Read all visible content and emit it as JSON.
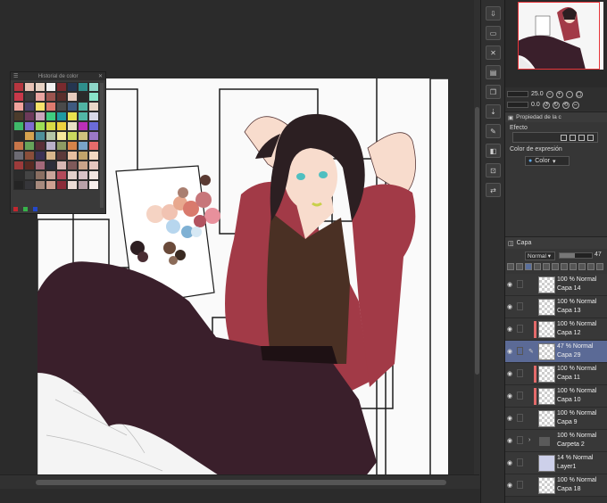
{
  "color_history": {
    "title": "Historial de color",
    "swatches": [
      "#b5363f",
      "#e8c2b5",
      "#e7d2c4",
      "#f2f2f2",
      "#7a2a2e",
      "#253550",
      "#2f8f8c",
      "#8dd6c8",
      "#c7394a",
      "#3a3a3a",
      "#e9a5a1",
      "#9d5550",
      "#5b2e2c",
      "#e7ccbf",
      "#2a2a2a",
      "#88e4c9",
      "#f0a39d",
      "#48426a",
      "#f7e36b",
      "#de7b6f",
      "#4a4a4a",
      "#3f5a80",
      "#50b3a3",
      "#e9d7c8",
      "#4b3b2b",
      "#6e3a5a",
      "#c9a5bb",
      "#3fcd7f",
      "#1f9aa2",
      "#e9e14d",
      "#52b6a6",
      "#d8d8e8",
      "#3fb86a",
      "#7f6bd0",
      "#9cde55",
      "#d8da45",
      "#f0d23f",
      "#e9e0c5",
      "#ba2fb8",
      "#6b6bd9",
      "#2b2b2b",
      "#d5a24f",
      "#4d8f9a",
      "#b4c6a7",
      "#f6e89c",
      "#c9d95e",
      "#cfc27d",
      "#9a77c6",
      "#c7764a",
      "#67a45a",
      "#5a2f37",
      "#b9b0c8",
      "#8e9b64",
      "#d7844a",
      "#79a4c9",
      "#e66b6b",
      "#6d6b74",
      "#8a4e3a",
      "#3b3355",
      "#d7b78c",
      "#5c3a3a",
      "#e7bfa0",
      "#c1a46b",
      "#f2d9c2",
      "#9c3b3b",
      "#5a2b24",
      "#a3697a",
      "#2c2e3a",
      "#d6b8b5",
      "#7f5a5a",
      "#c9a38a",
      "#e4c6bf",
      "#2c2c2c",
      "#444444",
      "#8a6f62",
      "#c9a59a",
      "#b24a5a",
      "#e3d0cb",
      "#d8c2c7",
      "#f0e4e0",
      "#242424",
      "#36363a",
      "#a78a7e",
      "#cda192",
      "#8b2c3a",
      "#ecdcd6",
      "#b8a1a8",
      "#f7efec"
    ]
  },
  "icon_strip": {
    "icons": [
      "layer-export-icon",
      "layer-folder-icon",
      "delete-layer-icon",
      "new-raster-layer-icon",
      "copy-layer-icon",
      "merge-down-icon",
      "new-vector-layer-icon",
      "mask-layer-icon",
      "reference-layer-icon",
      "transfer-layer-icon"
    ]
  },
  "navigator": {
    "zoom": "25.0",
    "rotation": "0.0"
  },
  "properties": {
    "tab_label": "Propiedad de la c",
    "effect_label": "Efecto",
    "expression_label": "Color de expresión",
    "expression_value": "Color"
  },
  "layers": {
    "tab_label": "Capa",
    "blend_mode": "Normal",
    "opacity": "47",
    "items": [
      {
        "mode": "100 % Normal",
        "name": "Capa 14",
        "selected": false,
        "clip": false,
        "type": "raster"
      },
      {
        "mode": "100 % Normal",
        "name": "Capa 13",
        "selected": false,
        "clip": false,
        "type": "raster"
      },
      {
        "mode": "100 % Normal",
        "name": "Capa 12",
        "selected": false,
        "clip": true,
        "type": "raster"
      },
      {
        "mode": "47 % Normal",
        "name": "Capa 29",
        "selected": true,
        "clip": false,
        "type": "raster"
      },
      {
        "mode": "100 % Normal",
        "name": "Capa 11",
        "selected": false,
        "clip": true,
        "type": "raster"
      },
      {
        "mode": "100 % Normal",
        "name": "Capa 10",
        "selected": false,
        "clip": true,
        "type": "raster"
      },
      {
        "mode": "100 % Normal",
        "name": "Capa 9",
        "selected": false,
        "clip": false,
        "type": "raster"
      },
      {
        "mode": "100 % Normal",
        "name": "Carpeta 2",
        "selected": false,
        "clip": false,
        "type": "folder"
      },
      {
        "mode": "14 % Normal",
        "name": "Layer1",
        "selected": false,
        "clip": false,
        "type": "art"
      },
      {
        "mode": "100 % Normal",
        "name": "Capa 18",
        "selected": false,
        "clip": false,
        "type": "raster"
      }
    ]
  },
  "colors": {
    "jacket": "#a23a47",
    "pants": "#3a1f2b",
    "shirt": "#4a3024",
    "skin": "#f8dccd",
    "hair": "#2c1f22",
    "selection": "#5b6a96"
  }
}
